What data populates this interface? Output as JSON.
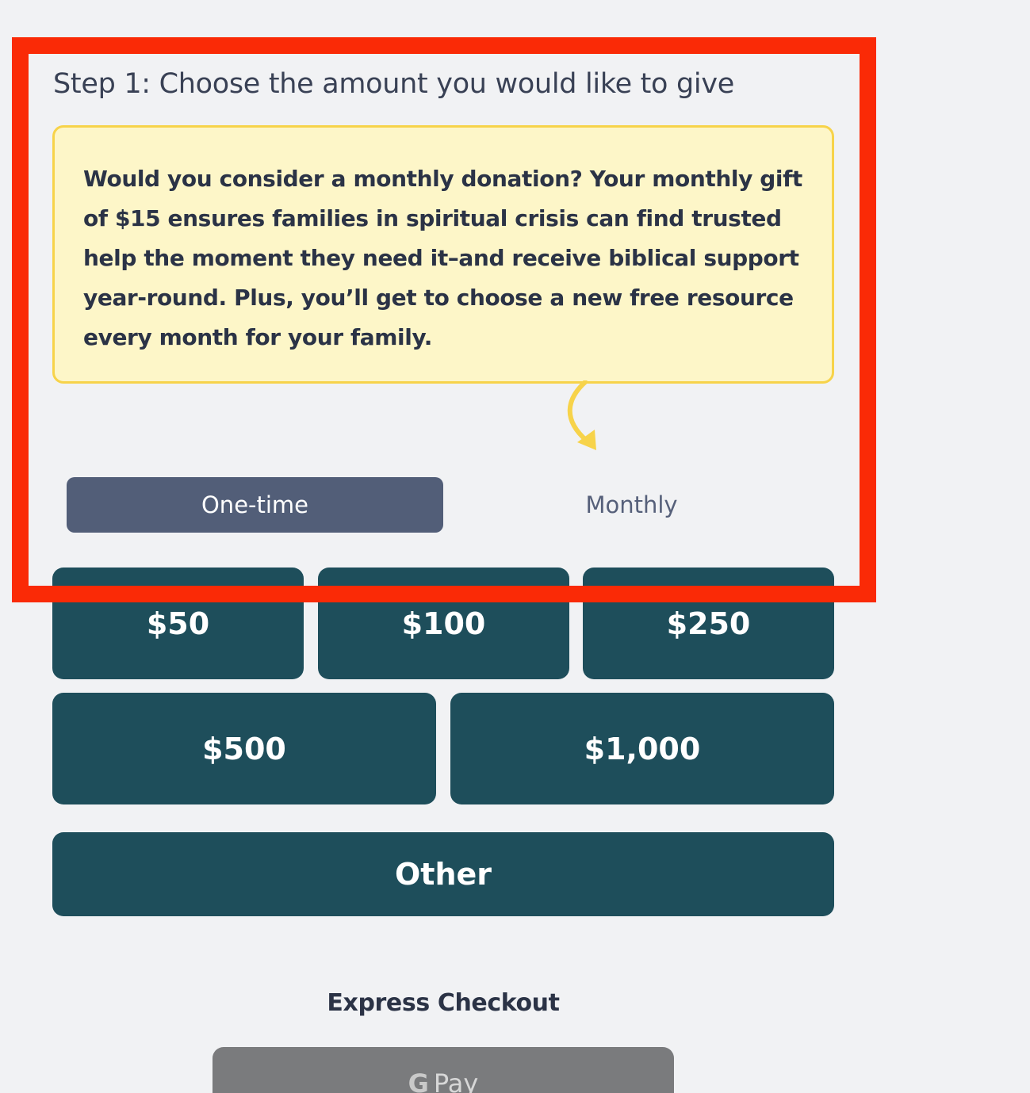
{
  "step": {
    "title": "Step 1: Choose the amount you would like to give"
  },
  "callout": {
    "text": "Would you consider a monthly donation? Your monthly gift of $15 ensures families in spiritual crisis can find trusted help the moment they need it–and receive biblical support year-round. Plus, you’ll get to choose a new free resource every month for your family."
  },
  "frequency": {
    "options": [
      {
        "label": "One-time",
        "selected": true
      },
      {
        "label": "Monthly",
        "selected": false
      }
    ]
  },
  "amounts": {
    "a50": "$50",
    "a100": "$100",
    "a250": "$250",
    "a500": "$500",
    "a1000": "$1,000",
    "other": "Other"
  },
  "express": {
    "label": "Express Checkout",
    "gpay_g": "G",
    "gpay_text": "Pay"
  },
  "colors": {
    "background": "#f1f2f4",
    "callout_bg": "#fdf6c8",
    "callout_border": "#f7d34a",
    "toggle_active": "#525e78",
    "amount_button": "#1e4e5b",
    "highlight": "#fa2a06",
    "gpay_button": "#7a7b7d"
  },
  "icons": {
    "arrow": "curved-arrow-down-icon",
    "gpay": "google-g-icon"
  }
}
